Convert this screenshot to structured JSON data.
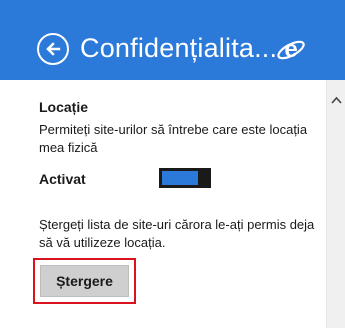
{
  "header": {
    "title": "Confidențialita...",
    "bg_color": "#2b79d8",
    "back_icon": "back-arrow-circle-icon",
    "app_icon": "internet-explorer-logo"
  },
  "location": {
    "heading": "Locație",
    "description": "Permiteți site-urilor să întrebe care este locația mea fizică",
    "toggle_label": "Activat",
    "toggle_on": true
  },
  "clear": {
    "description": "Ștergeți lista de site-uri cărora le-ați permis deja să vă utilizeze locația.",
    "button_label": "Ștergere",
    "highlight_color": "#d9121e"
  },
  "scrollbar": {
    "up_icon": "chevron-up-icon"
  }
}
